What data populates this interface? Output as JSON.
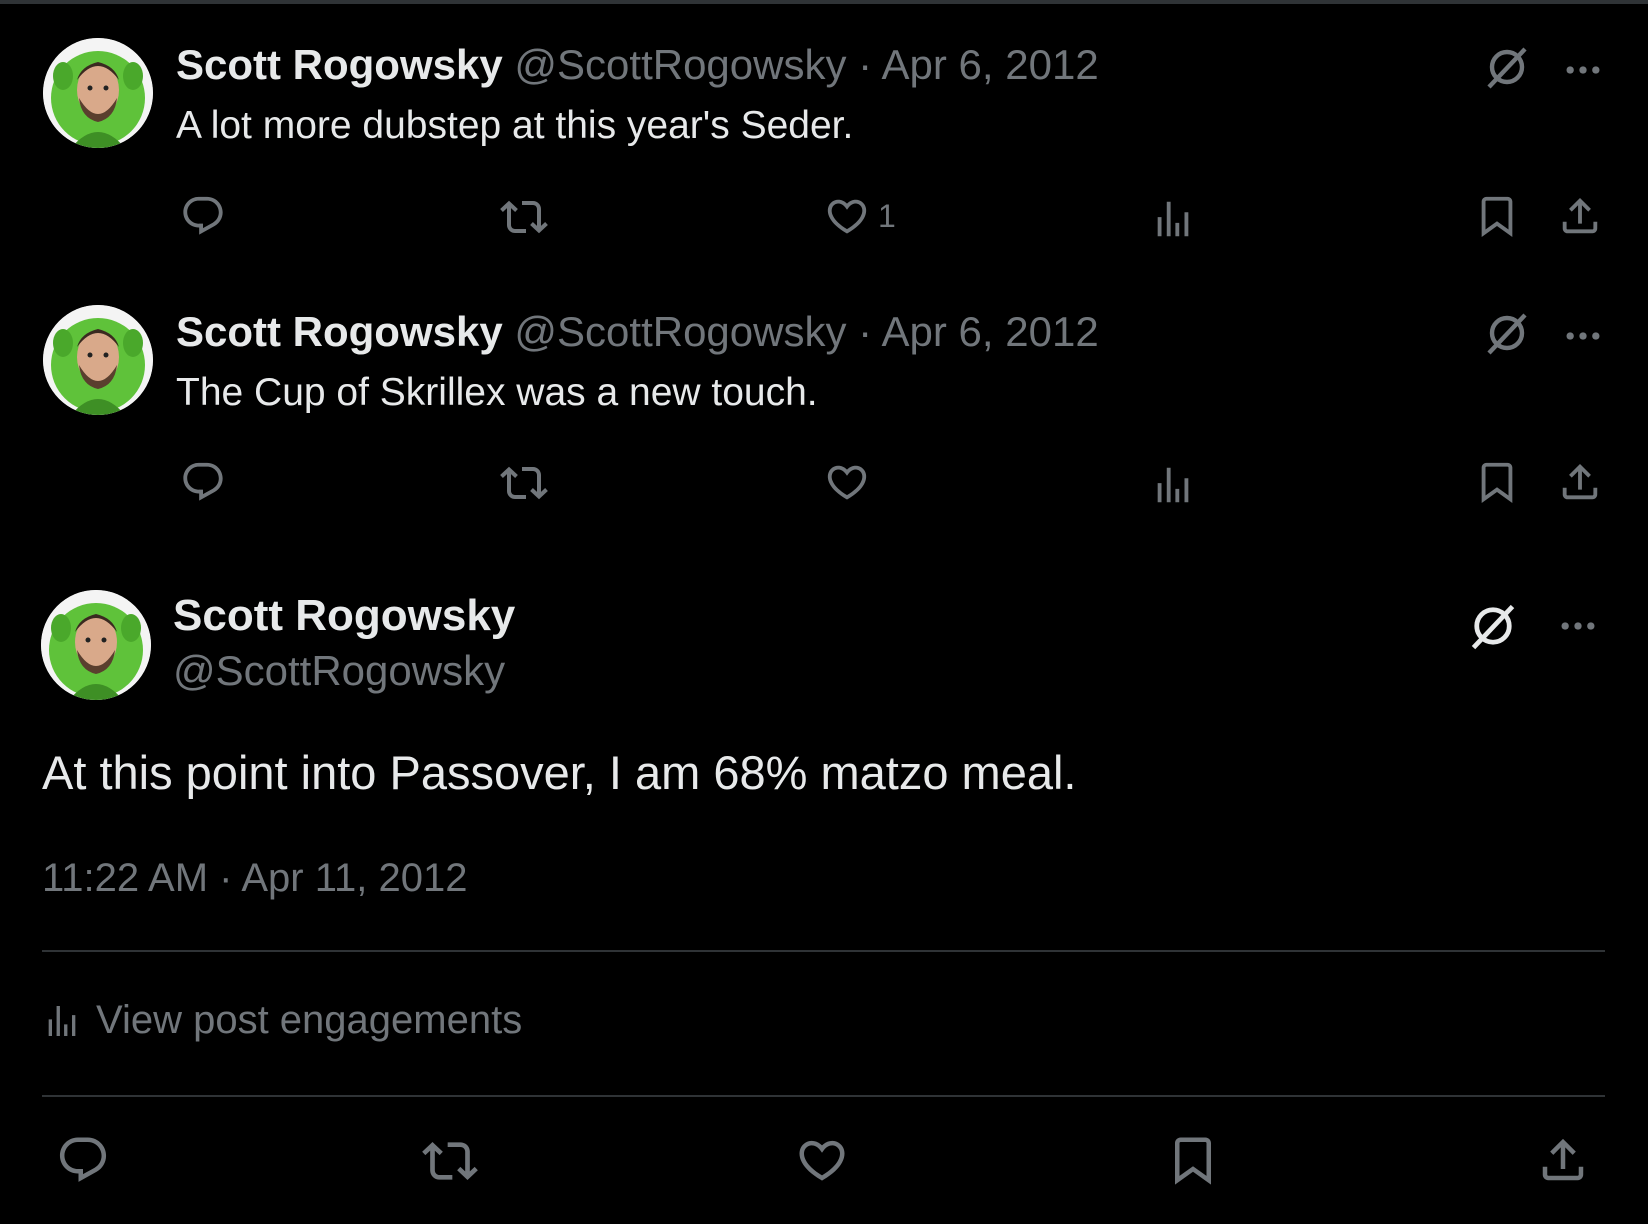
{
  "colors": {
    "background": "#000000",
    "text": "#e7e9ea",
    "muted": "#71767b",
    "divider": "#2f3336"
  },
  "tweets": [
    {
      "display_name": "Scott Rogowsky",
      "handle": "@ScottRogowsky",
      "separator": "·",
      "date": "Apr 6, 2012",
      "text": "A lot more dubstep at this year's Seder.",
      "like_count": "1",
      "icons": [
        "reply-icon",
        "retweet-icon",
        "like-icon",
        "views-icon",
        "bookmark-icon",
        "share-icon",
        "grok-icon",
        "more-icon"
      ]
    },
    {
      "display_name": "Scott Rogowsky",
      "handle": "@ScottRogowsky",
      "separator": "·",
      "date": "Apr 6, 2012",
      "text": "The Cup of Skrillex was a new touch.",
      "like_count": "",
      "icons": [
        "reply-icon",
        "retweet-icon",
        "like-icon",
        "views-icon",
        "bookmark-icon",
        "share-icon",
        "grok-icon",
        "more-icon"
      ]
    }
  ],
  "main_tweet": {
    "display_name": "Scott Rogowsky",
    "handle": "@ScottRogowsky",
    "text": "At this point into Passover, I am 68% matzo meal.",
    "timestamp": "11:22 AM · Apr 11, 2012",
    "engagements_label": "View post engagements",
    "icons": [
      "reply-icon",
      "retweet-icon",
      "like-icon",
      "bookmark-icon",
      "share-icon",
      "grok-icon",
      "more-icon",
      "analytics-icon"
    ]
  }
}
